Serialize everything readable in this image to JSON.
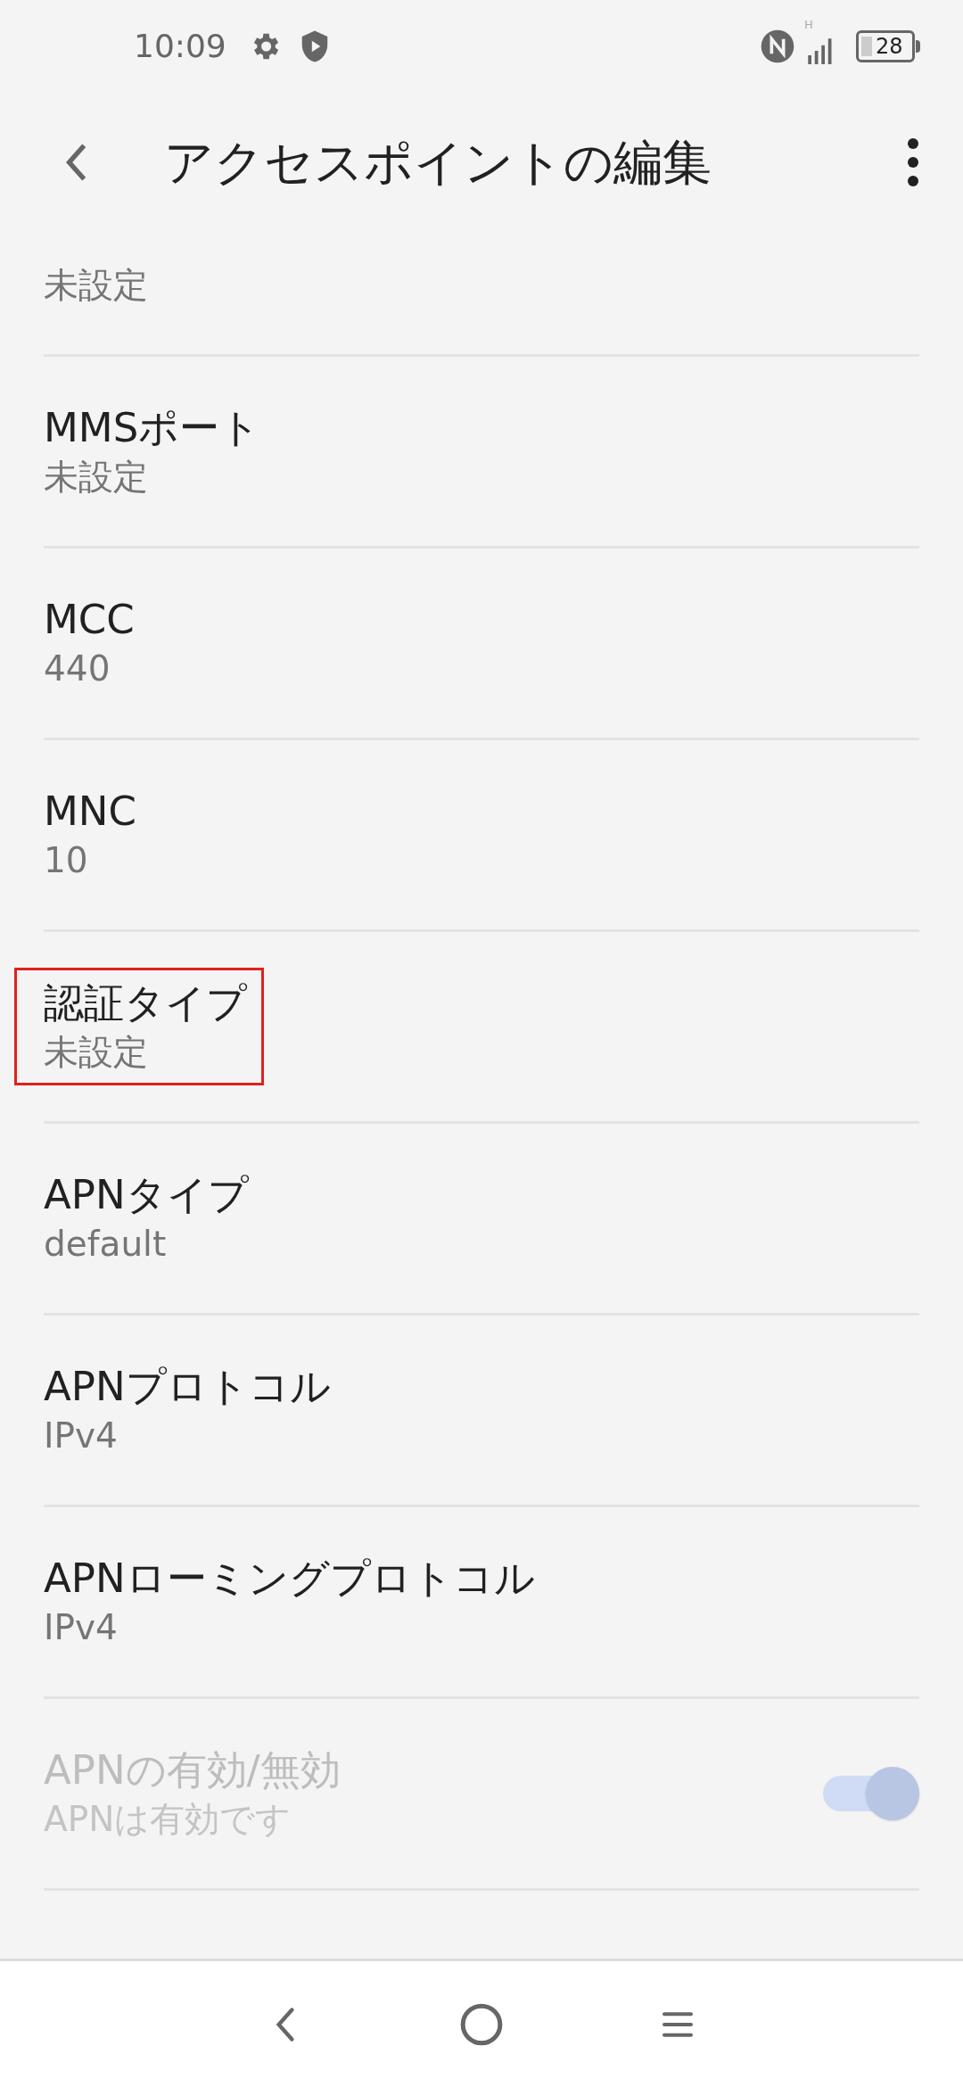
{
  "status_bar": {
    "time": "10:09",
    "network": "H",
    "battery": "28"
  },
  "app_bar": {
    "title": "アクセスポイントの編集"
  },
  "settings": [
    {
      "kind": "text",
      "value": "未設定",
      "highlighted": false,
      "disabled": false
    },
    {
      "kind": "text",
      "title": "MMSポート",
      "value": "未設定",
      "highlighted": false,
      "disabled": false
    },
    {
      "kind": "text",
      "title": "MCC",
      "value": "440",
      "highlighted": false,
      "disabled": false
    },
    {
      "kind": "text",
      "title": "MNC",
      "value": "10",
      "highlighted": false,
      "disabled": false
    },
    {
      "kind": "text",
      "title": "認証タイプ",
      "value": "未設定",
      "highlighted": true,
      "disabled": false
    },
    {
      "kind": "text",
      "title": "APNタイプ",
      "value": "default",
      "highlighted": false,
      "disabled": false
    },
    {
      "kind": "text",
      "title": "APNプロトコル",
      "value": "IPv4",
      "highlighted": false,
      "disabled": false
    },
    {
      "kind": "text",
      "title": "APNローミングプロトコル",
      "value": "IPv4",
      "highlighted": false,
      "disabled": false
    },
    {
      "kind": "switch",
      "title": "APNの有効/無効",
      "value": "APNは有効です",
      "highlighted": false,
      "disabled": true,
      "on": true
    }
  ]
}
